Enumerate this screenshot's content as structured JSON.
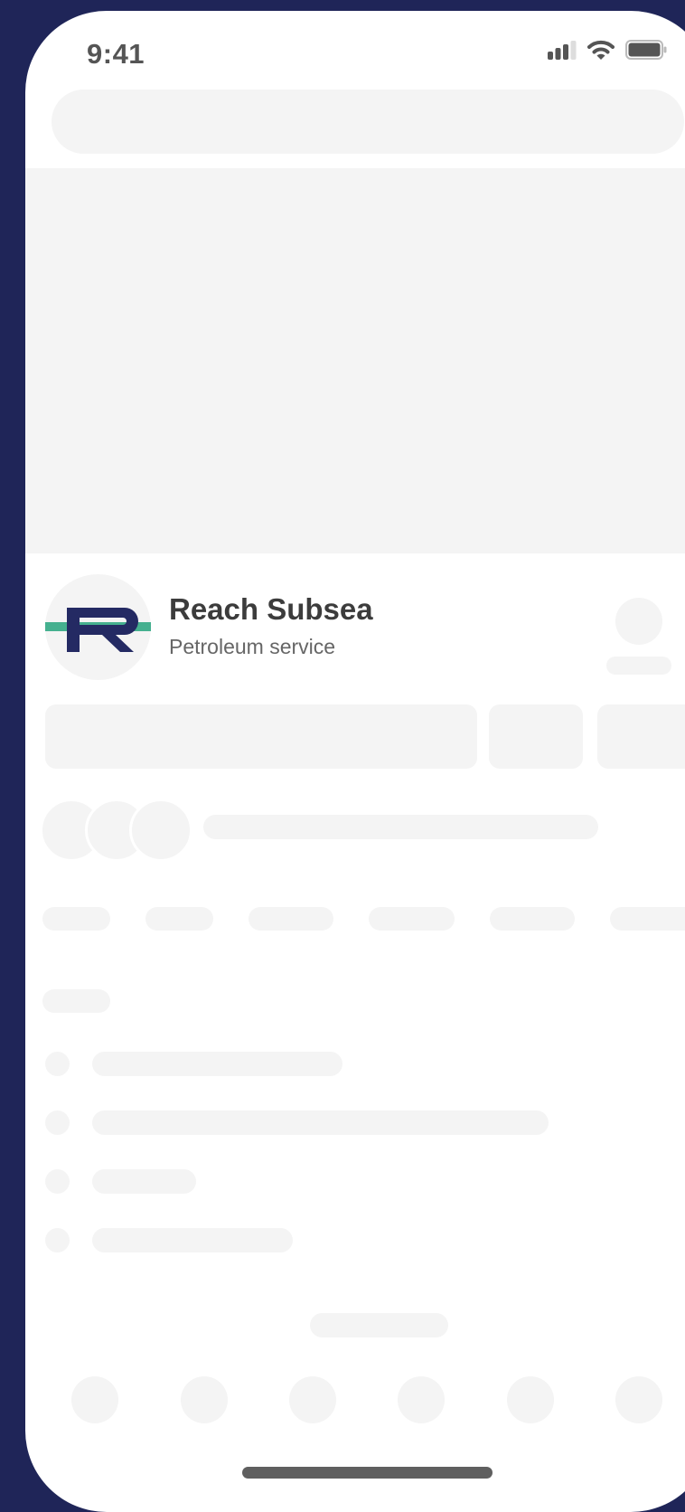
{
  "status_bar": {
    "time": "9:41",
    "icons": [
      "cellular-signal-icon",
      "wifi-icon",
      "battery-icon"
    ]
  },
  "company": {
    "name": "Reach Subsea",
    "category": "Petroleum service",
    "logo_letter": "R"
  },
  "colors": {
    "frame": "#1f2558",
    "logo_navy": "#242a63",
    "logo_green": "#45b08f",
    "skeleton": "#f4f4f4",
    "name_text": "#3c3c3c",
    "secondary_text": "#666666"
  }
}
